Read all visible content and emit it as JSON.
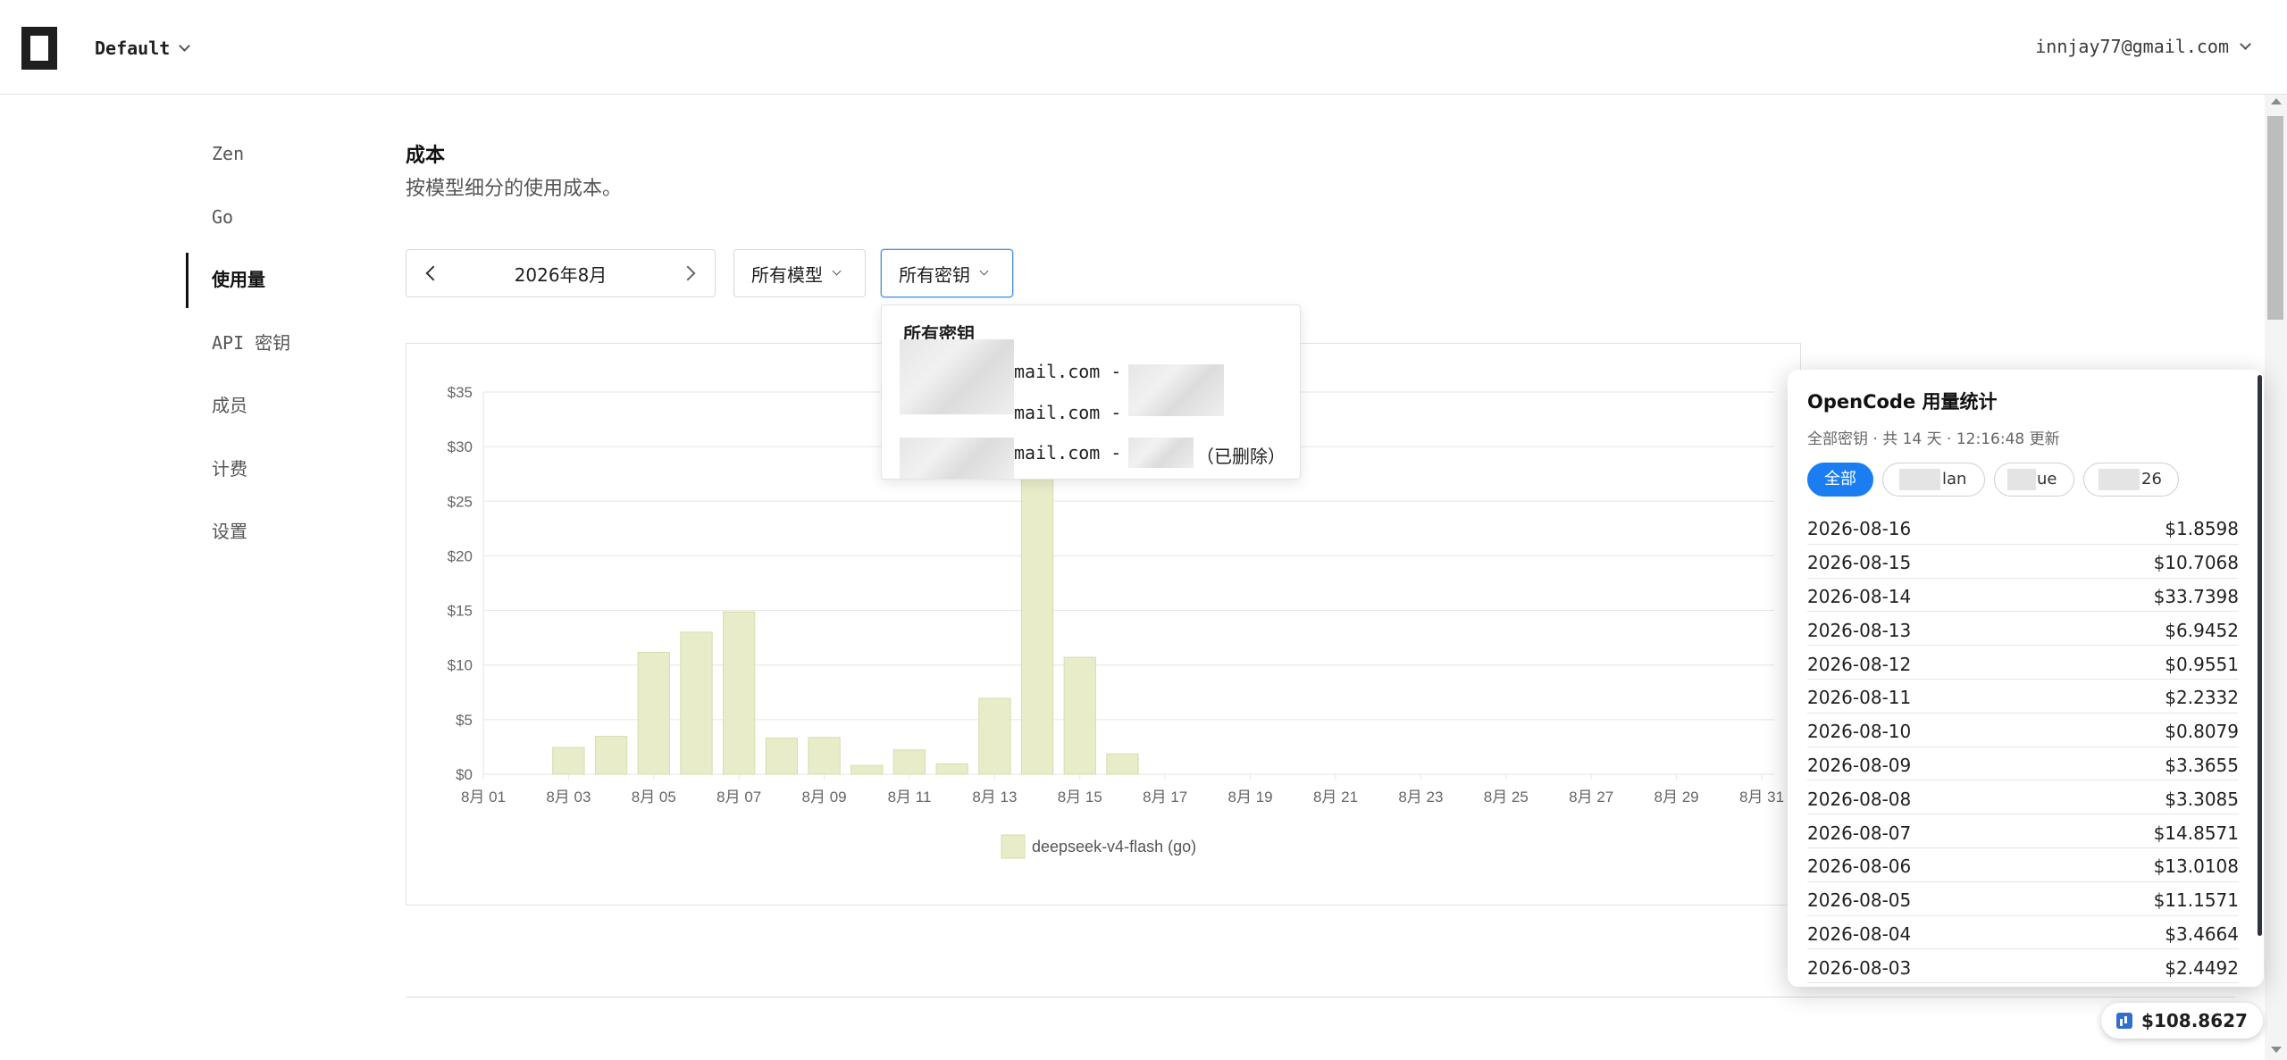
{
  "header": {
    "workspace": "Default",
    "account": "innjay77@gmail.com"
  },
  "sidebar": {
    "items": [
      {
        "label": "Zen",
        "active": false
      },
      {
        "label": "Go",
        "active": false
      },
      {
        "label": "使用量",
        "active": true
      },
      {
        "label": "API 密钥",
        "active": false
      },
      {
        "label": "成员",
        "active": false
      },
      {
        "label": "计费",
        "active": false
      },
      {
        "label": "设置",
        "active": false
      }
    ]
  },
  "page": {
    "title": "成本",
    "subtitle": "按模型细分的使用成本。"
  },
  "filters": {
    "month": "2026年8月",
    "models": "所有模型",
    "keys": "所有密钥"
  },
  "keys_dropdown": {
    "title": "所有密钥",
    "items": [
      "mail.com -",
      "mail.com -",
      "mail.com -"
    ],
    "deleted_label": "（已删除）"
  },
  "chart_data": {
    "type": "bar",
    "categories": [
      "8月 01",
      "8月 02",
      "8月 03",
      "8月 04",
      "8月 05",
      "8月 06",
      "8月 07",
      "8月 08",
      "8月 09",
      "8月 10",
      "8月 11",
      "8月 12",
      "8月 13",
      "8月 14",
      "8月 15",
      "8月 16",
      "8月 17",
      "8月 18",
      "8月 19",
      "8月 20",
      "8月 21",
      "8月 22",
      "8月 23",
      "8月 24",
      "8月 25",
      "8月 26",
      "8月 27",
      "8月 28",
      "8月 29",
      "8月 30",
      "8月 31"
    ],
    "tick_labels": [
      "8月 01",
      "8月 03",
      "8月 05",
      "8月 07",
      "8月 09",
      "8月 11",
      "8月 13",
      "8月 15",
      "8月 17",
      "8月 19",
      "8月 21",
      "8月 23",
      "8月 25",
      "8月 27",
      "8月 29",
      "8月 31"
    ],
    "series": [
      {
        "name": "deepseek-v4-flash (go)",
        "color": "#e9ecc8",
        "border": "#d7dcae",
        "values": [
          0,
          0,
          2.4492,
          3.4664,
          11.1571,
          13.0108,
          14.8571,
          3.3085,
          3.3655,
          0.8079,
          2.2332,
          0.9551,
          6.9452,
          33.7398,
          10.7068,
          1.8598,
          0,
          0,
          0,
          0,
          0,
          0,
          0,
          0,
          0,
          0,
          0,
          0,
          0,
          0,
          0
        ]
      }
    ],
    "ylim": [
      0,
      35
    ],
    "yticks": [
      "$0",
      "$5",
      "$10",
      "$15",
      "$20",
      "$25",
      "$30",
      "$35"
    ],
    "legend_position": "bottom",
    "grid": true
  },
  "stats_panel": {
    "title": "OpenCode 用量统计",
    "subtitle": "全部密钥 · 共 14 天 · 12:16:48 更新",
    "pills": [
      {
        "label": "全部",
        "active": true
      },
      {
        "label": "lan",
        "active": false
      },
      {
        "label": "ue",
        "active": false
      },
      {
        "label": "26",
        "active": false
      }
    ],
    "rows": [
      {
        "date": "2026-08-16",
        "cost": "$1.8598"
      },
      {
        "date": "2026-08-15",
        "cost": "$10.7068"
      },
      {
        "date": "2026-08-14",
        "cost": "$33.7398"
      },
      {
        "date": "2026-08-13",
        "cost": "$6.9452"
      },
      {
        "date": "2026-08-12",
        "cost": "$0.9551"
      },
      {
        "date": "2026-08-11",
        "cost": "$2.2332"
      },
      {
        "date": "2026-08-10",
        "cost": "$0.8079"
      },
      {
        "date": "2026-08-09",
        "cost": "$3.3655"
      },
      {
        "date": "2026-08-08",
        "cost": "$3.3085"
      },
      {
        "date": "2026-08-07",
        "cost": "$14.8571"
      },
      {
        "date": "2026-08-06",
        "cost": "$13.0108"
      },
      {
        "date": "2026-08-05",
        "cost": "$11.1571"
      },
      {
        "date": "2026-08-04",
        "cost": "$3.4664"
      },
      {
        "date": "2026-08-03",
        "cost": "$2.4492"
      }
    ]
  },
  "total_badge": {
    "icon": "bar-chart-icon",
    "value": "$108.8627"
  }
}
